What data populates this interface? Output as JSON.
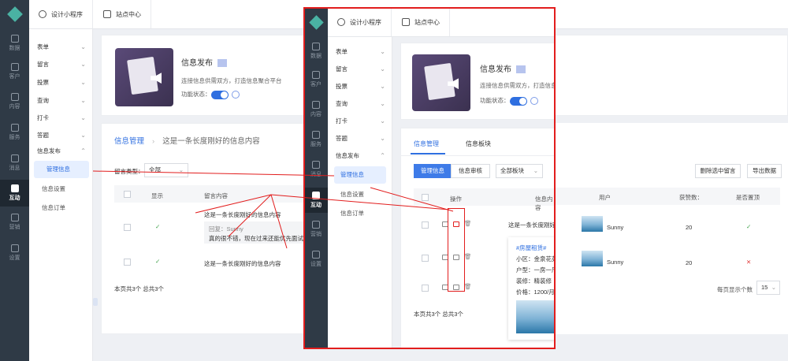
{
  "nav": {
    "items": [
      {
        "label": "数据"
      },
      {
        "label": "客户"
      },
      {
        "label": "内容"
      },
      {
        "label": "服务"
      },
      {
        "label": "消息"
      },
      {
        "label": "互动"
      },
      {
        "label": "营销"
      },
      {
        "label": "设置"
      }
    ]
  },
  "tabs": [
    {
      "label": "设计小程序"
    },
    {
      "label": "站点中心"
    }
  ],
  "sidebar": {
    "items": [
      {
        "label": "表单"
      },
      {
        "label": "留言"
      },
      {
        "label": "投票"
      },
      {
        "label": "查询"
      },
      {
        "label": "打卡"
      },
      {
        "label": "答题"
      },
      {
        "label": "信息发布"
      }
    ],
    "subs": [
      {
        "label": "管理信息"
      },
      {
        "label": "信息设置"
      },
      {
        "label": "信息订单"
      }
    ]
  },
  "hero": {
    "title": "信息发布",
    "desc": "连接信息供需双方，打造信息聚合平台",
    "desc_short": "连接信息供需双方，打造信息",
    "status_label": "功能状态："
  },
  "bg": {
    "breadcrumb_a": "信息管理",
    "breadcrumb_b": "这是一条长度刚好的信息内容",
    "filter_label": "留言类型：",
    "filter_value": "全部",
    "col_show": "显示",
    "col_content": "留言内容",
    "row1_text": "这是一条长度刚好的信息内容",
    "reply": "回复：Sunny",
    "reply_text": "真的很不错，现在过来还能优先面试",
    "row2_text": "这是一条长度刚好的信息内容",
    "footer": "本页共3个  总共3个"
  },
  "fg": {
    "tab_manage": "信息管理",
    "tab_board": "信息板块",
    "btn_manage": "管理信息",
    "btn_review": "信息审核",
    "board_select": "全部板块",
    "btn_delete": "删除选中留言",
    "btn_export": "导出数据",
    "cols": [
      "操作",
      "信息内容",
      "用户",
      "获赞数：",
      "是否置顶"
    ],
    "rows": [
      {
        "content": "这是一条长度刚好的",
        "user": "Sunny",
        "likes": "20",
        "top": "✓"
      },
      {
        "user": "Sunny",
        "likes": "20",
        "top": "✕"
      }
    ],
    "popup": {
      "tag": "#房屋租赁#",
      "lines": [
        "小区：金泉花苑",
        "户型：一房一厅",
        "装修：精装修",
        "价格：1200/月"
      ]
    },
    "footer": "本页共3个  总共3个",
    "page_size_label": "每页显示个数",
    "page_size": "15"
  }
}
